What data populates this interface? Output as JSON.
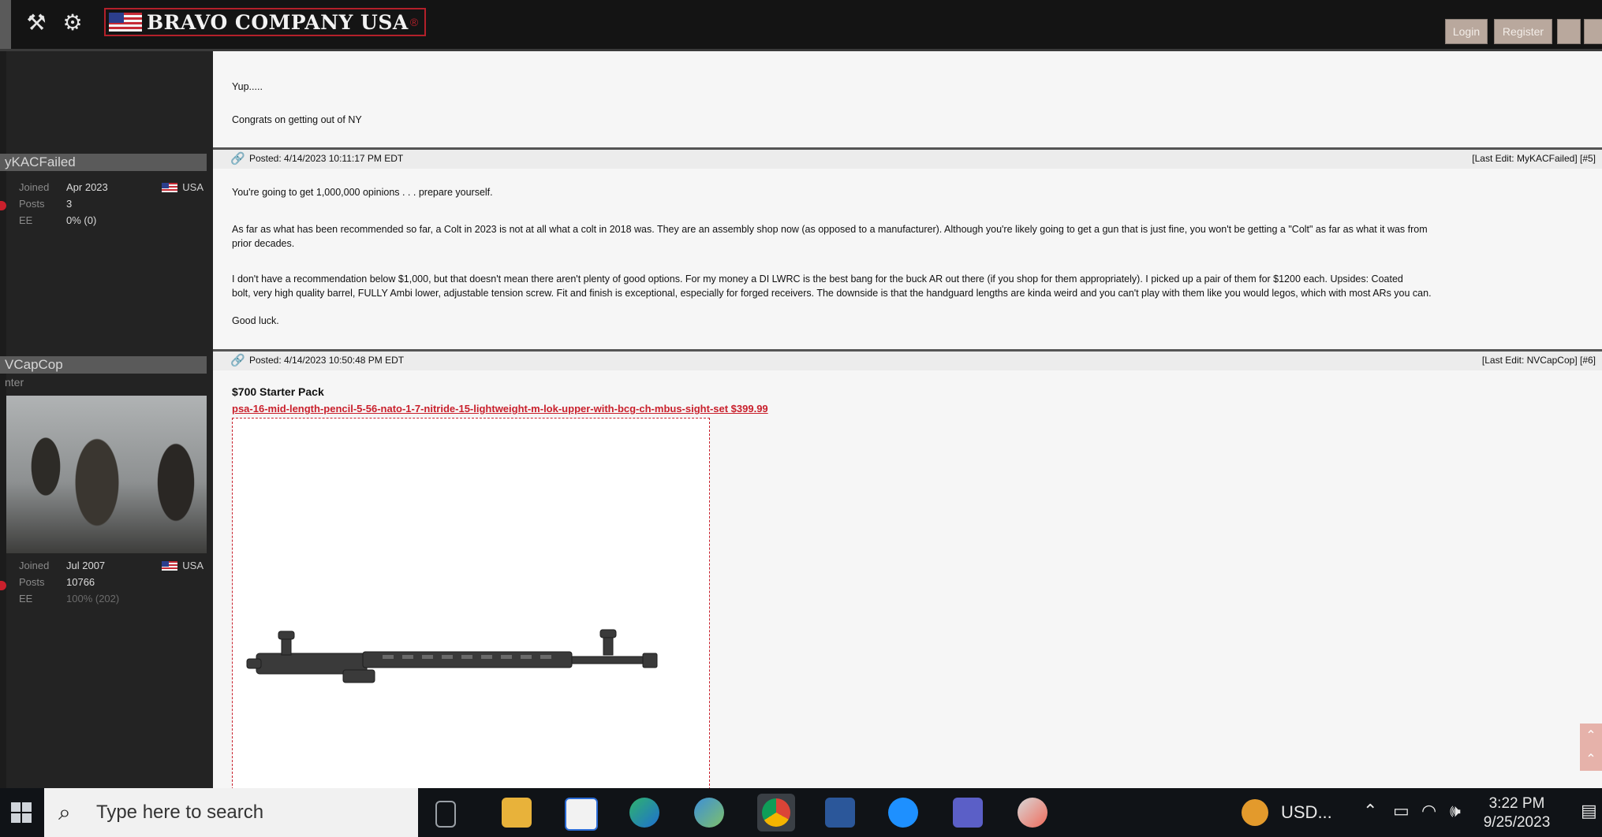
{
  "header": {
    "brand_text": "BRAVO COMPANY USA",
    "brand_mark": "®",
    "buttons": [
      "Login",
      "Register"
    ]
  },
  "sidebar": {
    "users": [
      {
        "name": "yKACFailed",
        "joined_key": "Joined",
        "joined": "Apr 2023",
        "posts_key": "Posts",
        "posts": "3",
        "ee_key": "EE",
        "ee": "0% (0)",
        "country": "USA"
      },
      {
        "name": "VCapCop",
        "subtitle": "nter",
        "joined_key": "Joined",
        "joined": "Jul 2007",
        "posts_key": "Posts",
        "posts": "10766",
        "ee_key": "EE",
        "ee": "100% (202)",
        "country": "USA"
      }
    ]
  },
  "posts": [
    {
      "lines": [
        "Yup.....",
        "Congrats on getting out of NY"
      ]
    },
    {
      "posted": "Posted: 4/14/2023 10:11:17 PM EDT",
      "last_edit": "[Last Edit: MyKACFailed] [#5]",
      "lines": [
        "You're going to get 1,000,000 opinions . . . prepare yourself.",
        "As far as what has been recommended so far, a Colt in 2023 is not at all what a colt in 2018 was.  They are an assembly shop now (as opposed to a manufacturer).  Although you're likely going to get a gun that is just fine, you won't be getting a \"Colt\" as far as what it was from",
        "prior decades.",
        "I don't have a recommendation below $1,000, but that doesn't mean there aren't plenty of good options.  For my money a DI LWRC is the best bang for the buck AR out there (if you shop for them appropriately).  I picked up a pair of them for $1200 each.  Upsides:  Coated",
        "bolt, very high quality barrel, FULLY Ambi lower, adjustable tension screw.  Fit and finish is exceptional, especially for forged receivers.  The downside is that the handguard lengths are kinda weird and you can't play with them like you would legos, which with most ARs you can.",
        "Good luck."
      ]
    },
    {
      "posted": "Posted: 4/14/2023 10:50:48 PM EDT",
      "last_edit": "[Last Edit: NVCapCop] [#6]",
      "title": "$700 Starter Pack",
      "link": "psa-16-mid-length-pencil-5-56-nato-1-7-nitride-15-lightweight-m-lok-upper-with-bcg-ch-mbus-sight-set $399.99"
    }
  ],
  "taskbar": {
    "search_placeholder": "Type here to search",
    "currency": "USD...",
    "time": "3:22 PM",
    "date": "9/25/2023"
  }
}
